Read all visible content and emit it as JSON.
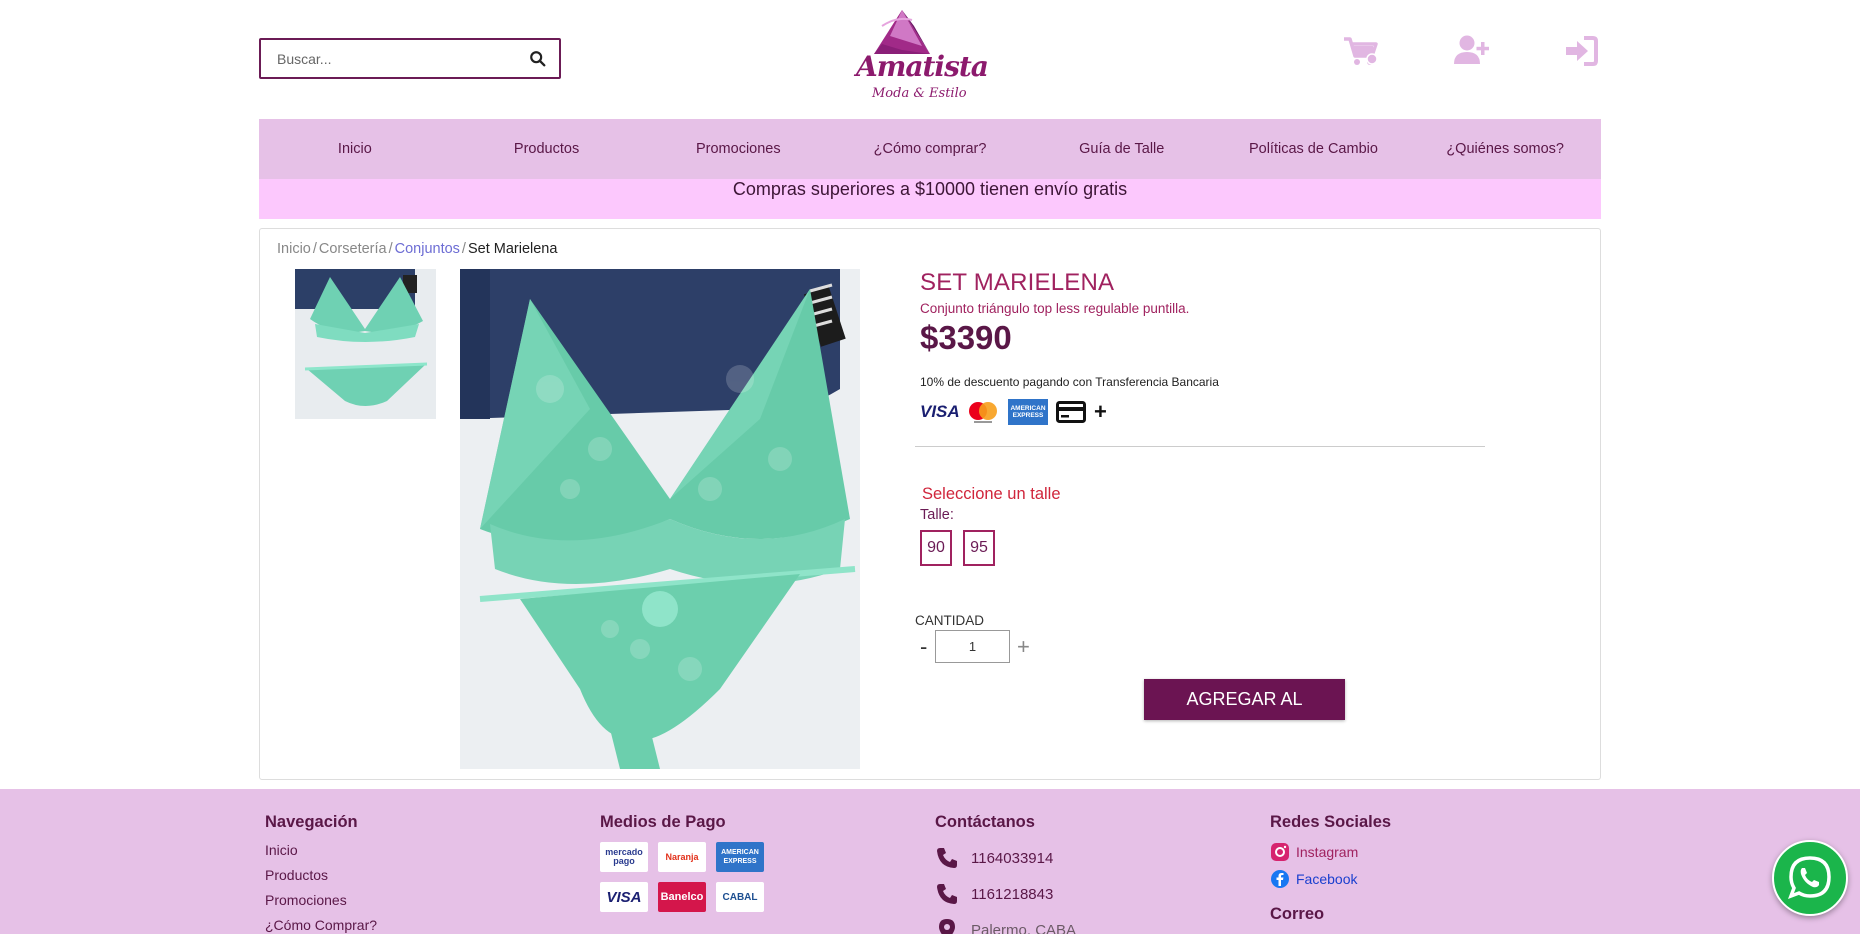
{
  "search": {
    "placeholder": "Buscar..."
  },
  "logo": {
    "brand": "Amatista",
    "tagline": "Moda & Estilo"
  },
  "header_icons": [
    "cart-icon",
    "user-plus-icon",
    "sign-in-icon"
  ],
  "nav": {
    "items": [
      {
        "label": "Inicio"
      },
      {
        "label": "Productos"
      },
      {
        "label": "Promociones"
      },
      {
        "label": "¿Cómo comprar?"
      },
      {
        "label": "Guía de Talle"
      },
      {
        "label": "Políticas de Cambio"
      },
      {
        "label": "¿Quiénes somos?"
      }
    ]
  },
  "promo_banner": "Compras superiores a $10000 tienen envío gratis",
  "breadcrumb": {
    "items": [
      "Inicio",
      "Corsetería",
      "Conjuntos"
    ],
    "current": "Set Marielena",
    "separator": "/"
  },
  "product": {
    "title": "SET MARIELENA",
    "description": "Conjunto triángulo top less regulable puntilla.",
    "price": "$3390",
    "discount_note": "10% de descuento pagando con Transferencia Bancaria",
    "payment_icons": [
      "visa-icon",
      "mastercard-icon",
      "amex-icon",
      "credit-card-icon",
      "plus-icon"
    ],
    "visa_text": "VISA",
    "amex_text": "AMERICAN EXPRESS",
    "more_symbol": "+",
    "size_prompt": "Seleccione un talle",
    "size_label": "Talle:",
    "sizes": [
      "90",
      "95"
    ],
    "quantity_label": "CANTIDAD",
    "quantity_value": "1",
    "minus": "-",
    "plus": "+",
    "add_to_cart": "AGREGAR AL CARRITO"
  },
  "colors": {
    "primary": "#6b1452",
    "nav_bg": "#e6c1e7",
    "promo_bg": "#fcc8fd",
    "title": "#a0225f",
    "alert": "#d0253b",
    "whatsapp": "#1bb54b"
  },
  "footer": {
    "nav": {
      "heading": "Navegación",
      "links": [
        "Inicio",
        "Productos",
        "Promociones",
        "¿Cómo Comprar?"
      ]
    },
    "payments": {
      "heading": "Medios de Pago",
      "logos": [
        {
          "name": "mercadopago-logo",
          "text": "mercado pago"
        },
        {
          "name": "naranja-logo",
          "text": "Naranja"
        },
        {
          "name": "amex-logo",
          "text": "AMERICAN EXPRESS"
        },
        {
          "name": "visa-logo",
          "text": "VISA"
        },
        {
          "name": "banelco-logo",
          "text": "Banelco"
        },
        {
          "name": "cabal-logo",
          "text": "CABAL"
        }
      ]
    },
    "contact": {
      "heading": "Contáctanos",
      "phone1": "1164033914",
      "phone2": "1161218843",
      "location": "Palermo, CABA"
    },
    "social": {
      "heading": "Redes Sociales",
      "instagram": "Instagram",
      "facebook": "Facebook",
      "mail_heading": "Correo"
    }
  }
}
